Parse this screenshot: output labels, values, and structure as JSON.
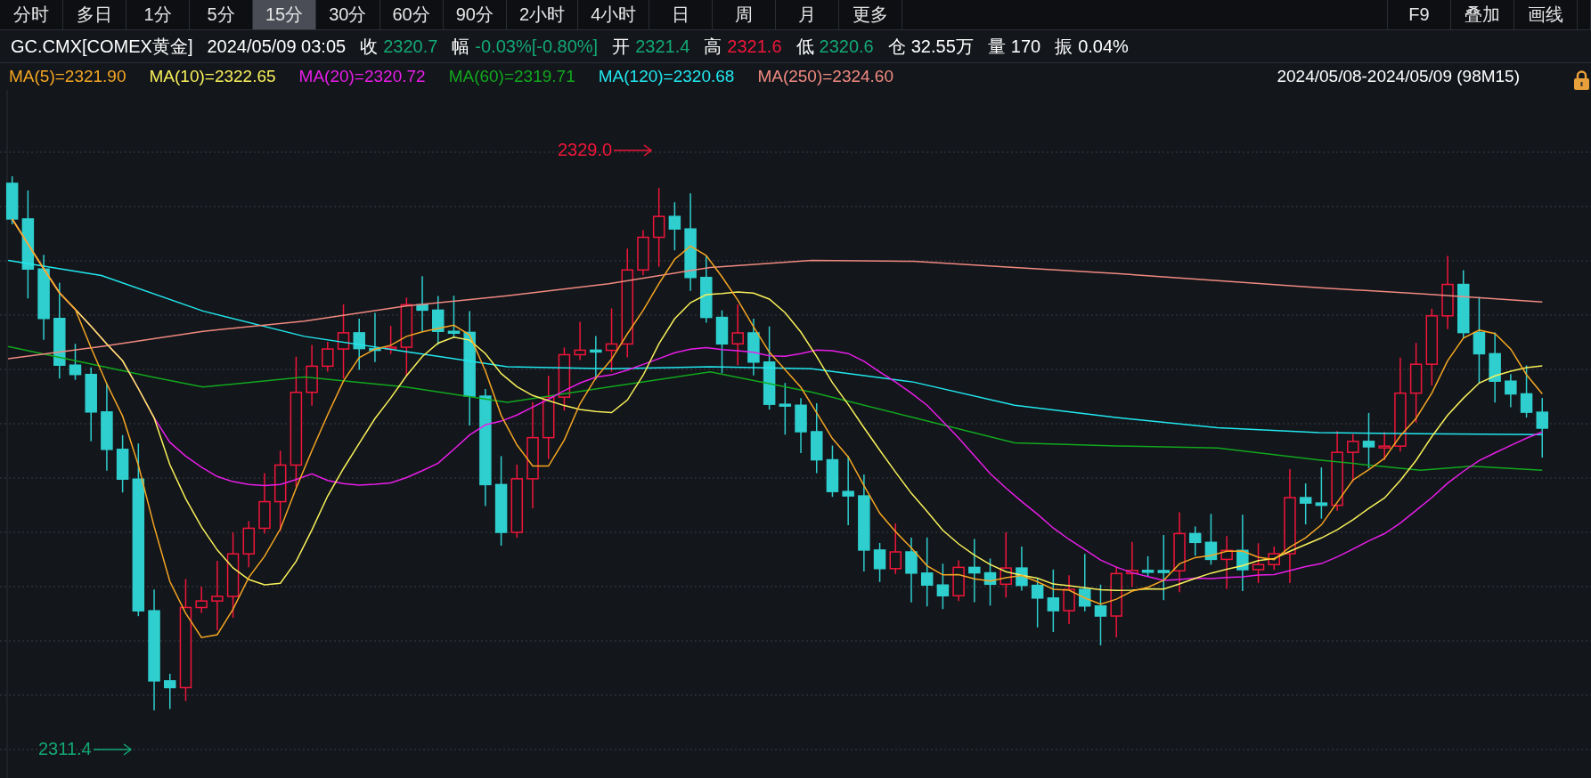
{
  "toolbar": {
    "tabs": [
      {
        "label": "分时",
        "selected": false
      },
      {
        "label": "多日",
        "selected": false
      },
      {
        "label": "1分",
        "selected": false
      },
      {
        "label": "5分",
        "selected": false
      },
      {
        "label": "15分",
        "selected": true
      },
      {
        "label": "30分",
        "selected": false
      },
      {
        "label": "60分",
        "selected": false
      },
      {
        "label": "90分",
        "selected": false
      },
      {
        "label": "2小时",
        "selected": false
      },
      {
        "label": "4小时",
        "selected": false
      },
      {
        "label": "日",
        "selected": false
      },
      {
        "label": "周",
        "selected": false
      },
      {
        "label": "月",
        "selected": false
      },
      {
        "label": "更多",
        "selected": false
      }
    ],
    "actions": [
      "F9",
      "叠加",
      "画线"
    ]
  },
  "quote": {
    "symbol": "GC.CMX[COMEX黄金]",
    "datetime": "2024/05/09 03:05",
    "fields": [
      {
        "label": "收",
        "value": "2320.7",
        "color": "#13a874"
      },
      {
        "label": "幅",
        "value": "-0.03%[-0.80%]",
        "color": "#13a874"
      },
      {
        "label": "开",
        "value": "2321.4",
        "color": "#13a874"
      },
      {
        "label": "高",
        "value": "2321.6",
        "color": "#f0163a"
      },
      {
        "label": "低",
        "value": "2320.6",
        "color": "#13a874"
      },
      {
        "label": "仓",
        "value": "32.55万",
        "color": "#ffffff"
      },
      {
        "label": "量",
        "value": "170",
        "color": "#ffffff"
      },
      {
        "label": "振",
        "value": "0.04%",
        "color": "#ffffff"
      }
    ]
  },
  "legend": {
    "items": [
      {
        "text": "MA(5)=2321.90",
        "color": "#f5a623"
      },
      {
        "text": "MA(10)=2322.65",
        "color": "#f8f05a"
      },
      {
        "text": "MA(20)=2320.72",
        "color": "#e81ee8"
      },
      {
        "text": "MA(60)=2319.71",
        "color": "#12a81e"
      },
      {
        "text": "MA(120)=2320.68",
        "color": "#21e8ef"
      },
      {
        "text": "MA(250)=2324.60",
        "color": "#f08a80"
      }
    ],
    "range": "2024/05/08-2024/05/09 (98M15)"
  },
  "chart": {
    "high_label": "2329.0",
    "low_label": "2311.4"
  }
}
